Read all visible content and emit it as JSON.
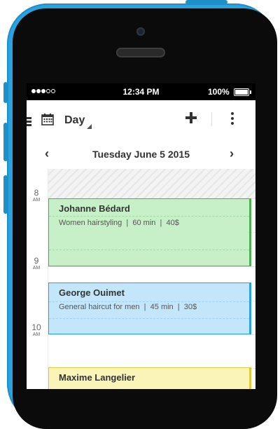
{
  "status_bar": {
    "time": "12:34 PM",
    "battery": "100%"
  },
  "toolbar": {
    "view": "Day"
  },
  "date_nav": {
    "prev": "‹",
    "next": "›",
    "title": "Tuesday June 5 2015"
  },
  "hours": [
    {
      "hour": "8",
      "period": "AM"
    },
    {
      "hour": "9",
      "period": "AM"
    },
    {
      "hour": "10",
      "period": "AM"
    }
  ],
  "appointments": [
    {
      "name": "Johanne Bédard",
      "service": "Women hairstyling",
      "duration": "60 min",
      "price": "40$",
      "color": "#c8f0c8",
      "border": "#4caf50"
    },
    {
      "name": "George Ouimet",
      "service": "General haircut for men",
      "duration": "45 min",
      "price": "30$",
      "color": "#c4e6fb",
      "border": "#29a3e0"
    },
    {
      "name": "Maxime Langelier",
      "service": "",
      "duration": "",
      "price": "",
      "color": "#faf4b8",
      "border": "#e0c93a"
    }
  ],
  "icons": {
    "menu": "menu-icon",
    "calendar": "calendar-icon",
    "add": "plus-icon",
    "more": "more-vertical-icon"
  }
}
